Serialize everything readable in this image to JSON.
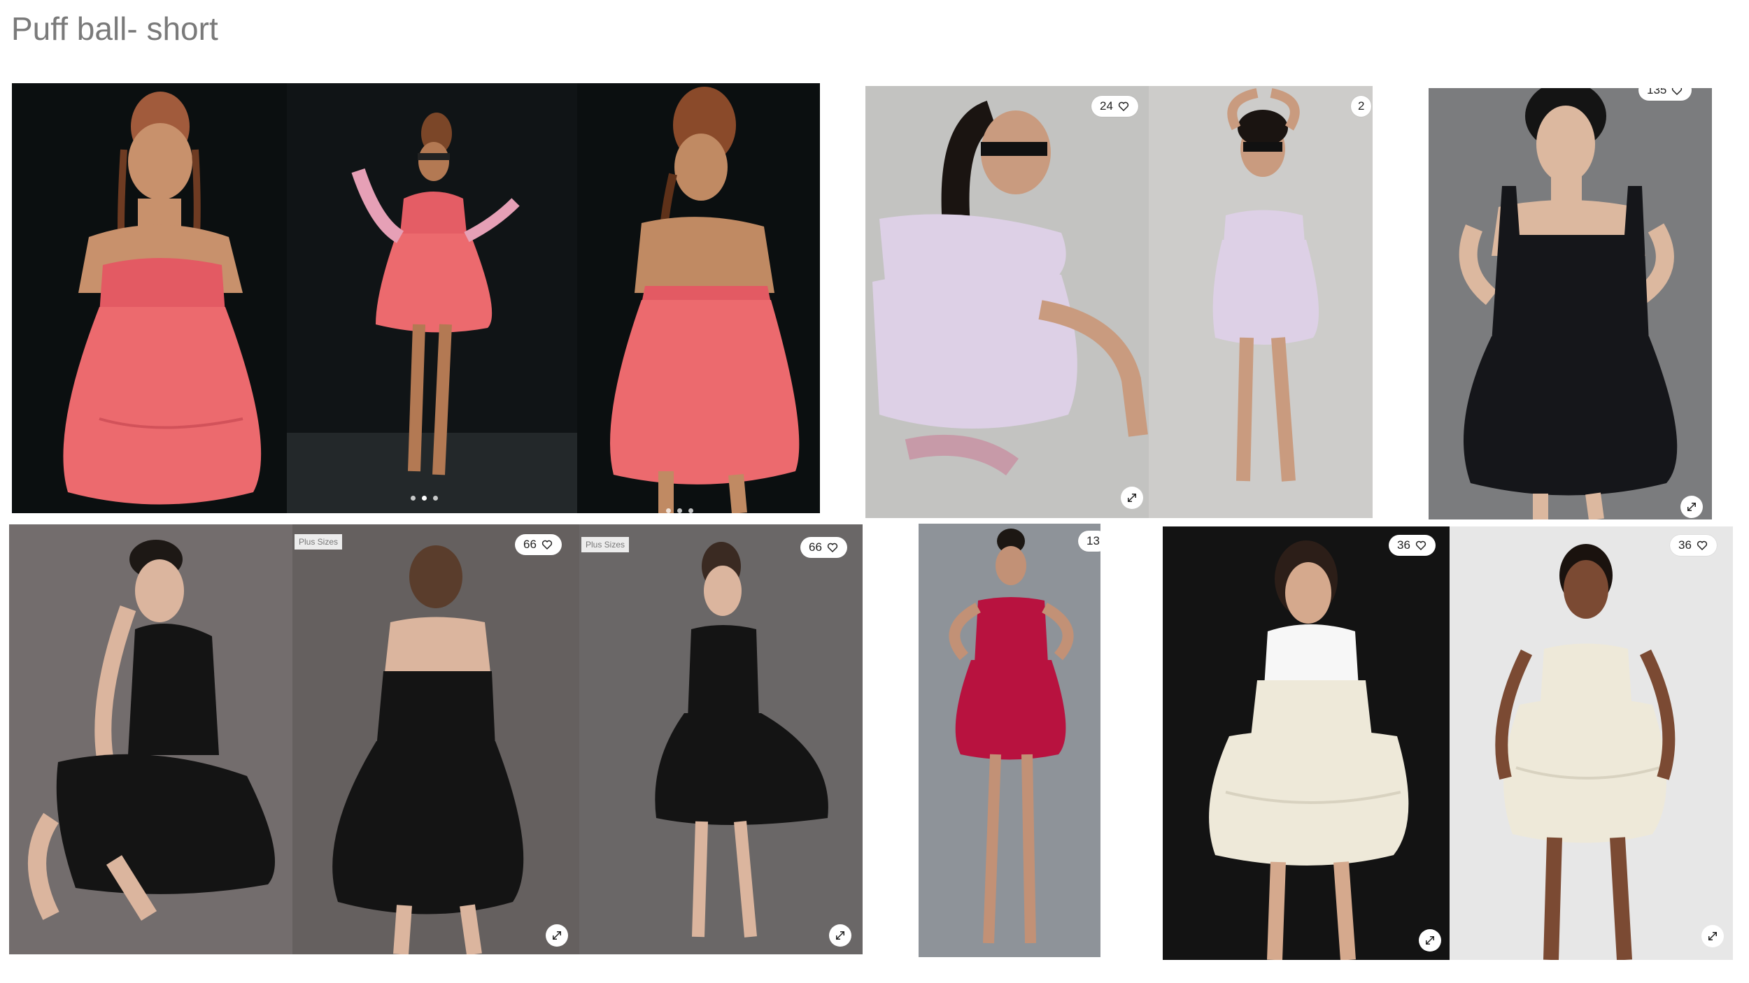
{
  "page": {
    "title": "Puff ball- short"
  },
  "products": [
    {
      "id": "coral-bubble",
      "photo_count": 3,
      "dress_color": "#ec6a6e",
      "background": "#0b0f10"
    },
    {
      "id": "lilac-bow",
      "photo_count": 2,
      "likes": "24",
      "likes_second": "2",
      "dress_color": "#ddd0e6",
      "background": "#c6c6c4"
    },
    {
      "id": "black-corset",
      "photo_count": 1,
      "likes": "135",
      "dress_color": "#15161a",
      "background": "#7b7c7e"
    },
    {
      "id": "black-bubble",
      "photo_count": 3,
      "likes": "66",
      "tag": "Plus Sizes",
      "dress_color": "#141414",
      "background": "#6c6868"
    },
    {
      "id": "magenta-puff",
      "photo_count": 1,
      "likes": "13",
      "dress_color": "#b8123f",
      "background": "#8e9399"
    },
    {
      "id": "cream-tiered",
      "photo_count": 2,
      "likes": "36",
      "dress_color": "#eee9d9",
      "background": "#121212"
    }
  ],
  "icons": {
    "heart": "heart-icon",
    "expand": "expand-icon"
  }
}
